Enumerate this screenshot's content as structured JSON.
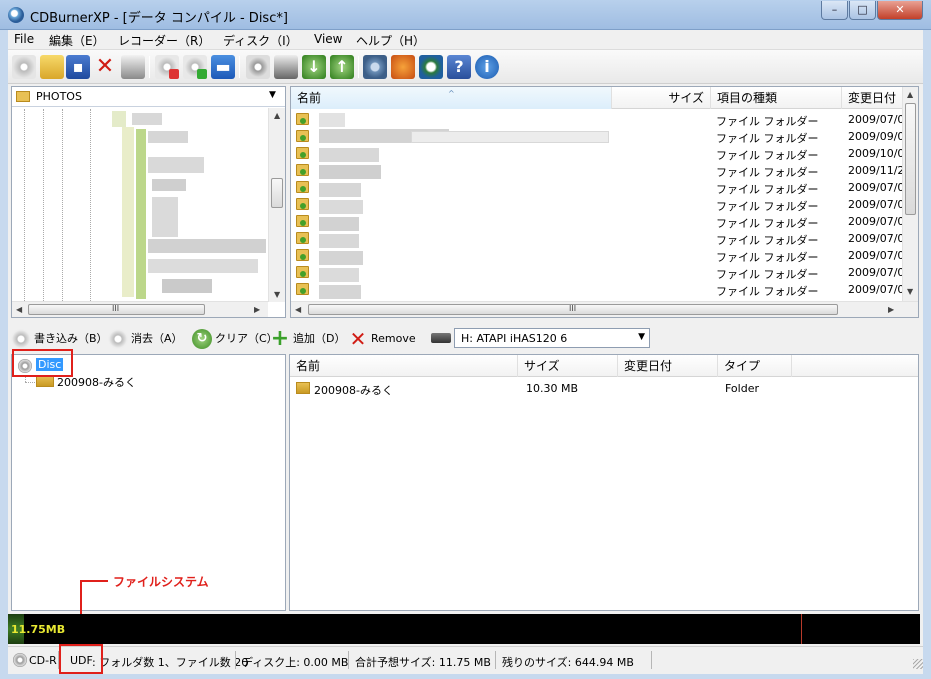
{
  "window": {
    "title": "CDBurnerXP - [データ コンパイル - Disc*]",
    "controls": {
      "minimize": "–",
      "maximize": "□",
      "close": "✕"
    }
  },
  "menu": [
    "File",
    "編集（E）",
    "レコーダー（R）",
    "ディスク（I）",
    "View",
    "ヘルプ（H）"
  ],
  "toolbar": {
    "icons": [
      "new-disc-icon",
      "open-icon",
      "save-icon",
      "delete-icon",
      "print-icon",
      "erase-disc-icon",
      "verify-disc-icon",
      "blue-disc-icon",
      "disc-info-icon",
      "drive-icon",
      "import-session-icon",
      "export-icon",
      "settings-icon",
      "browser-icon",
      "search-icon",
      "help-icon",
      "info-icon"
    ]
  },
  "explorer": {
    "folder_combo": "PHOTOS",
    "columns": {
      "name": "名前",
      "size": "サイズ",
      "type": "項目の種類",
      "date": "変更日付"
    },
    "rows": [
      {
        "type": "ファイル フォルダー",
        "date": "2009/07/0"
      },
      {
        "type": "ファイル フォルダー",
        "date": "2009/09/0"
      },
      {
        "type": "ファイル フォルダー",
        "date": "2009/10/0"
      },
      {
        "type": "ファイル フォルダー",
        "date": "2009/11/2"
      },
      {
        "type": "ファイル フォルダー",
        "date": "2009/07/0"
      },
      {
        "type": "ファイル フォルダー",
        "date": "2009/07/0"
      },
      {
        "type": "ファイル フォルダー",
        "date": "2009/07/0"
      },
      {
        "type": "ファイル フォルダー",
        "date": "2009/07/0"
      },
      {
        "type": "ファイル フォルダー",
        "date": "2009/07/0"
      },
      {
        "type": "ファイル フォルダー",
        "date": "2009/07/0"
      },
      {
        "type": "ファイル フォルダー",
        "date": "2009/07/0"
      }
    ],
    "scroll_mark": "III"
  },
  "compile_toolbar": {
    "burn": "書き込み（B）",
    "erase": "消去（A）",
    "clear": "クリア（C）",
    "add": "追加（D）",
    "remove": "Remove",
    "drive": "H: ATAPI iHAS120   6"
  },
  "disc_tree": {
    "root": "Disc",
    "child": "200908-みるく"
  },
  "compile_list": {
    "columns": {
      "name": "名前",
      "size": "サイズ",
      "date": "変更日付",
      "type": "タイプ"
    },
    "rows": [
      {
        "name": "200908-みるく",
        "size": "10.30 MB",
        "date": "",
        "type": "Folder"
      }
    ]
  },
  "capacity": {
    "used_label": "11.75MB",
    "used_fraction": 0.018
  },
  "status": {
    "media": "CD-R",
    "filesystem": "UDF",
    "counts": ": フォルダ数 1、ファイル数 20",
    "on_disc": "ディスク上: 0.00 MB",
    "estimated": "合計予想サイズ: 11.75 MB",
    "remaining": "残りのサイズ: 644.94 MB"
  },
  "annotation": "ファイルシステム",
  "colors": {
    "accent_red": "#e0201b",
    "capacity_bg": "#000000",
    "capacity_label": "#e8e832"
  }
}
